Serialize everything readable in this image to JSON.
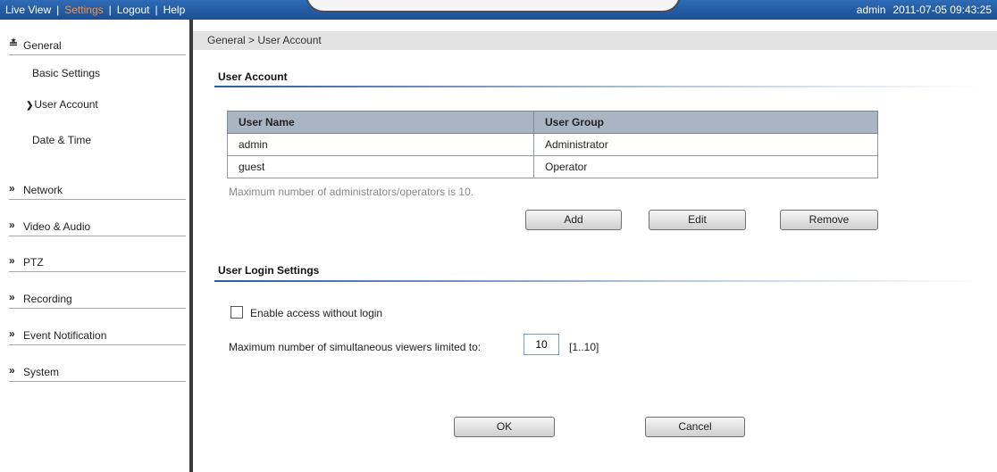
{
  "topbar": {
    "nav": [
      "Live View",
      "Settings",
      "Logout",
      "Help"
    ],
    "separator": "|",
    "user": "admin",
    "datetime": "2011-07-05 09:43:25"
  },
  "sidebar": {
    "general": {
      "label": "General",
      "items": [
        "Basic Settings",
        "User Account",
        "Date & Time"
      ]
    },
    "sections": [
      "Network",
      "Video & Audio",
      "PTZ",
      "Recording",
      "Event Notification",
      "System"
    ]
  },
  "breadcrumb": "General > User Account",
  "user_account": {
    "title": "User Account",
    "columns": [
      "User Name",
      "User Group"
    ],
    "rows": [
      [
        "admin",
        "Administrator"
      ],
      [
        "guest",
        "Operator"
      ]
    ],
    "note": "Maximum number of administrators/operators is 10.",
    "buttons": {
      "add": "Add",
      "edit": "Edit",
      "remove": "Remove"
    }
  },
  "login_settings": {
    "title": "User Login Settings",
    "enable_access_label": "Enable access without login",
    "enable_access_checked": false,
    "max_viewers_label": "Maximum number of simultaneous viewers limited to:",
    "max_viewers_value": "10",
    "range": "[1..10]"
  },
  "footer": {
    "ok": "OK",
    "cancel": "Cancel"
  },
  "colors": {
    "topbar": "#1f57a0",
    "active_nav": "#ff8c3a",
    "table_header": "#aab5c3"
  }
}
